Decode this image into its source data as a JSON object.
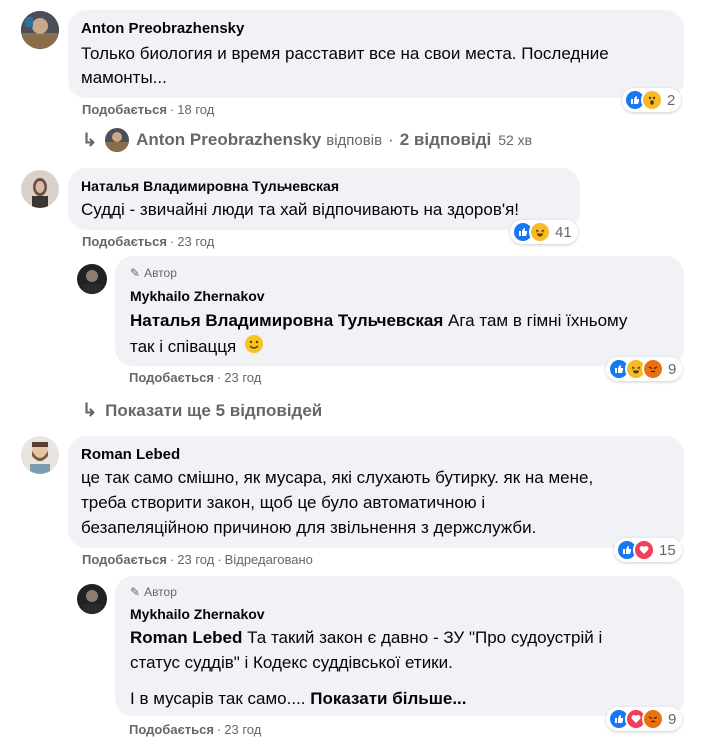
{
  "comments": [
    {
      "author": "Anton Preobrazhensky",
      "text_lines": [
        "Только биология и время расставит все на свои места. Последние",
        "мамонты..."
      ],
      "like_label": "Подобається",
      "time": "18 год",
      "reaction_count": "2"
    },
    {
      "author": "Наталья Владимировна Тульчевская",
      "text_lines": [
        "Судді - звичайні люди та хай відпочивають на здоров'я!"
      ],
      "like_label": "Подобається",
      "time": "23 год",
      "reaction_count": "41"
    },
    {
      "author": "Roman Lebed",
      "text_lines": [
        "це так само смішно, як мусара, які слухають бутирку. як на мене,",
        "треба створити закон, щоб це було автоматичною і",
        "безапеляційною причиною для звільнення з держслужби."
      ],
      "like_label": "Подобається",
      "time": "23 год",
      "edited": "Відредаговано",
      "reaction_count": "15"
    }
  ],
  "reply_summary": {
    "author": "Anton Preobrazhensky",
    "replied": "відповів",
    "count_label": "2 відповіді",
    "time": "52 хв"
  },
  "replies": [
    {
      "badge": "Автор",
      "author": "Mykhailo Zhernakov",
      "mention": "Наталья Владимировна Тульчевская",
      "text_first": "Ага там в гімні їхньому",
      "text_second": "так і співацця",
      "like_label": "Подобається",
      "time": "23 год",
      "reaction_count": "9"
    },
    {
      "badge": "Автор",
      "author": "Mykhailo Zhernakov",
      "mention": "Roman Lebed",
      "text_first": "Та такий закон є давно - ЗУ \"Про судоустрій і",
      "text_second": "статус суддів\" і Кодекс суддівської етики.",
      "text_third": "І в мусарів так само....",
      "see_more": "Показати більше...",
      "like_label": "Подобається",
      "time": "23 год",
      "reaction_count": "9"
    }
  ],
  "show_more_replies": "Показати ще 5 відповідей",
  "colors": {
    "bubble": "#f0f2f5",
    "meta": "#65676b",
    "like_blue": "#1877f2",
    "haha": "#f7b928",
    "love": "#f33e58",
    "angry": "#e9710f"
  }
}
